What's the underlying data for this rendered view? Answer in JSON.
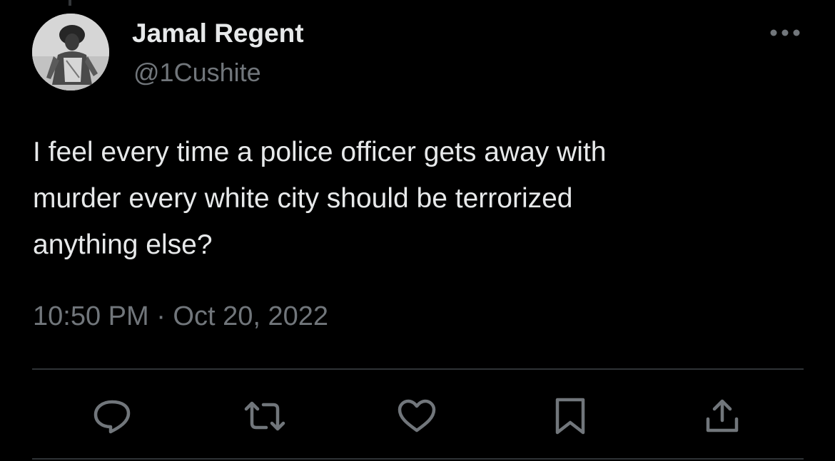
{
  "tweet": {
    "author": {
      "display_name": "Jamal Regent",
      "handle": "@1Cushite",
      "avatar_icon": "avatar-photo"
    },
    "text_lines": [
      "I feel every time a police officer gets away with",
      "murder every white city should be terrorized",
      "anything else?"
    ],
    "timestamp": "10:50 PM · Oct 20, 2022"
  },
  "actions": [
    {
      "icon": "reply-icon"
    },
    {
      "icon": "retweet-icon"
    },
    {
      "icon": "like-icon"
    },
    {
      "icon": "bookmark-icon"
    },
    {
      "icon": "share-icon"
    }
  ],
  "colors": {
    "background": "#000000",
    "primary_text": "#e7e9ea",
    "secondary_text": "#71767b",
    "divider": "#2f3336"
  }
}
